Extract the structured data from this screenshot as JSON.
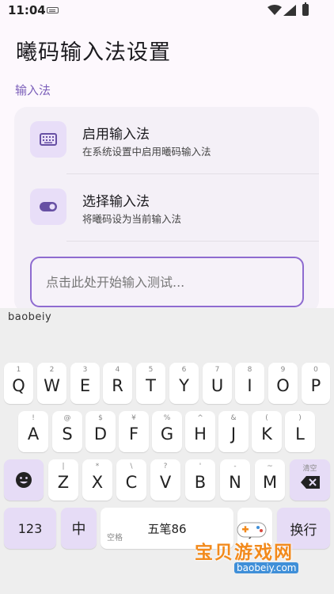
{
  "status_bar": {
    "time": "11:04"
  },
  "page_title": "曦码输入法设置",
  "section_label": "输入法",
  "items": [
    {
      "title": "启用输入法",
      "subtitle": "在系统设置中启用曦码输入法",
      "icon": "keyboard-icon"
    },
    {
      "title": "选择输入法",
      "subtitle": "将曦码设为当前输入法",
      "icon": "toggle-icon"
    }
  ],
  "test_input": {
    "placeholder": "点击此处开始输入测试..."
  },
  "keyboard": {
    "candidate": "baobeiy",
    "row1": [
      {
        "key": "Q",
        "alt": "1"
      },
      {
        "key": "W",
        "alt": "2"
      },
      {
        "key": "E",
        "alt": "3"
      },
      {
        "key": "R",
        "alt": "4"
      },
      {
        "key": "T",
        "alt": "5"
      },
      {
        "key": "Y",
        "alt": "6"
      },
      {
        "key": "U",
        "alt": "7"
      },
      {
        "key": "I",
        "alt": "8"
      },
      {
        "key": "O",
        "alt": "9"
      },
      {
        "key": "P",
        "alt": "0"
      }
    ],
    "row2": [
      {
        "key": "A",
        "alt": "!"
      },
      {
        "key": "S",
        "alt": "@"
      },
      {
        "key": "D",
        "alt": "$"
      },
      {
        "key": "F",
        "alt": "¥"
      },
      {
        "key": "G",
        "alt": "%"
      },
      {
        "key": "H",
        "alt": "^"
      },
      {
        "key": "J",
        "alt": "&"
      },
      {
        "key": "K",
        "alt": "("
      },
      {
        "key": "L",
        "alt": ")"
      }
    ],
    "row3": [
      {
        "key": "Z",
        "alt": "|"
      },
      {
        "key": "X",
        "alt": "*"
      },
      {
        "key": "C",
        "alt": "\\"
      },
      {
        "key": "V",
        "alt": "?"
      },
      {
        "key": "B",
        "alt": "'"
      },
      {
        "key": "N",
        "alt": "-"
      },
      {
        "key": "M",
        "alt": "~"
      }
    ],
    "backspace_alt": "清空",
    "num_key": "123",
    "zh_key": "中",
    "space_sub": "空格",
    "space_label": "五笔86",
    "enter_key": "换行",
    "emoji_icon": "emoji-icon",
    "backspace_icon": "backspace-icon"
  },
  "watermark": {
    "title": "宝贝游戏网",
    "url": "baobeiy.com"
  }
}
